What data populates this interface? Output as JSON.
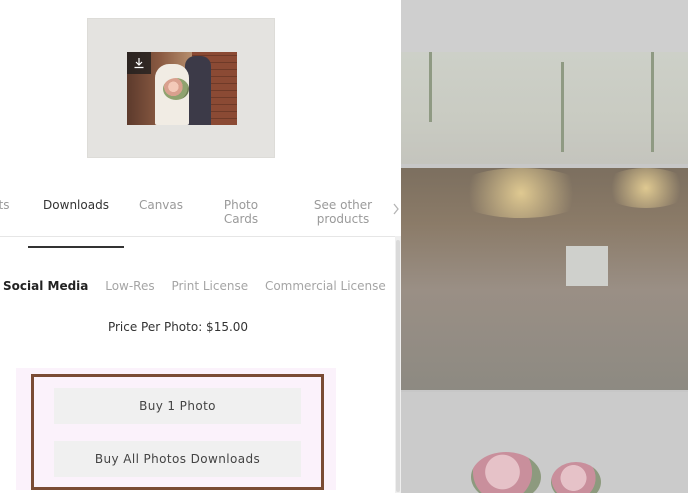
{
  "product_tabs": {
    "partial_label": "ts",
    "items": [
      {
        "label": "Downloads",
        "active": true
      },
      {
        "label": "Canvas",
        "active": false
      },
      {
        "label": "Photo\nCards",
        "active": false
      },
      {
        "label": "See other\nproducts",
        "active": false
      }
    ],
    "scroll_icon": "chevron-right-icon"
  },
  "preview": {
    "download_icon": "download-icon"
  },
  "licenses": {
    "items": [
      {
        "label": "Social Media",
        "active": true
      },
      {
        "label": "Low-Res",
        "active": false
      },
      {
        "label": "Print License",
        "active": false
      },
      {
        "label": "Commercial License",
        "active": false
      }
    ]
  },
  "pricing": {
    "price_text": "Price Per Photo: $15.00"
  },
  "actions": {
    "buy_one_label": "Buy 1 Photo",
    "buy_all_label": "Buy All Photos Downloads"
  },
  "colors": {
    "highlight_frame": "#7a4b34",
    "highlight_background": "#fbf2fb",
    "button_background": "#f0f0f0",
    "overlay_gray": "#c7c7c7"
  }
}
